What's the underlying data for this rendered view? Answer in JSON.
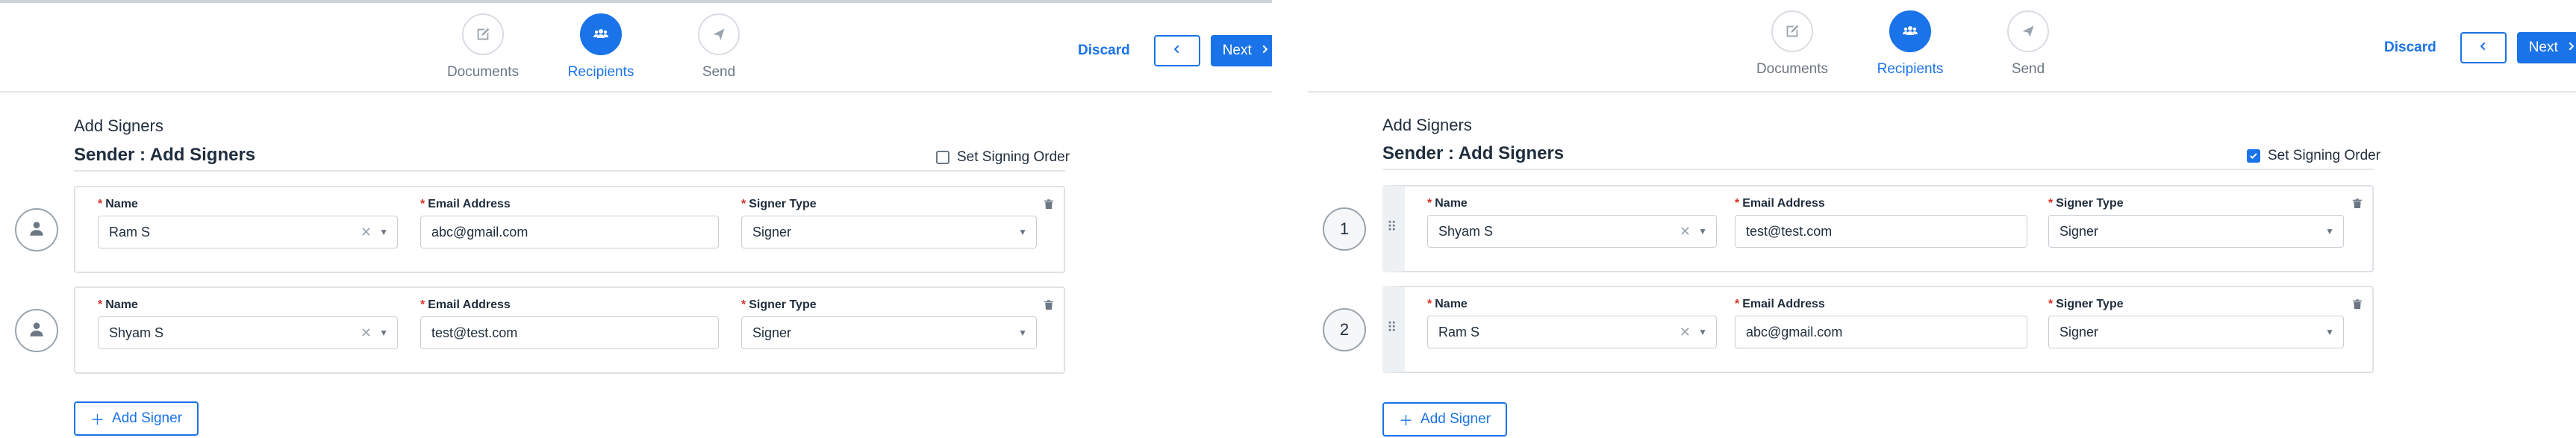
{
  "stepper": [
    {
      "label": "Documents",
      "icon": "document-icon",
      "state": "inactive"
    },
    {
      "label": "Recipients",
      "icon": "users-icon",
      "state": "active"
    },
    {
      "label": "Send",
      "icon": "send-icon",
      "state": "inactive"
    }
  ],
  "actions": {
    "discard": "Discard",
    "next": "Next"
  },
  "headings": {
    "add_signers": "Add Signers",
    "sender": "Sender : Add Signers"
  },
  "signing_order_label": "Set Signing Order",
  "labels": {
    "name": "Name",
    "email": "Email Address",
    "signer_type": "Signer Type"
  },
  "add_signer_label": "Add Signer",
  "left_panel": {
    "signing_order_checked": false,
    "signers": [
      {
        "name": "Ram S",
        "email": "abc@gmail.com",
        "type": "Signer"
      },
      {
        "name": "Shyam S",
        "email": "test@test.com",
        "type": "Signer"
      }
    ]
  },
  "right_panel": {
    "signing_order_checked": true,
    "signers": [
      {
        "order": "1",
        "name": "Shyam S",
        "email": "test@test.com",
        "type": "Signer"
      },
      {
        "order": "2",
        "name": "Ram S",
        "email": "abc@gmail.com",
        "type": "Signer"
      }
    ]
  },
  "colors": {
    "accent": "#1a73e8",
    "required": "#d93025",
    "border": "#dee2e6"
  }
}
